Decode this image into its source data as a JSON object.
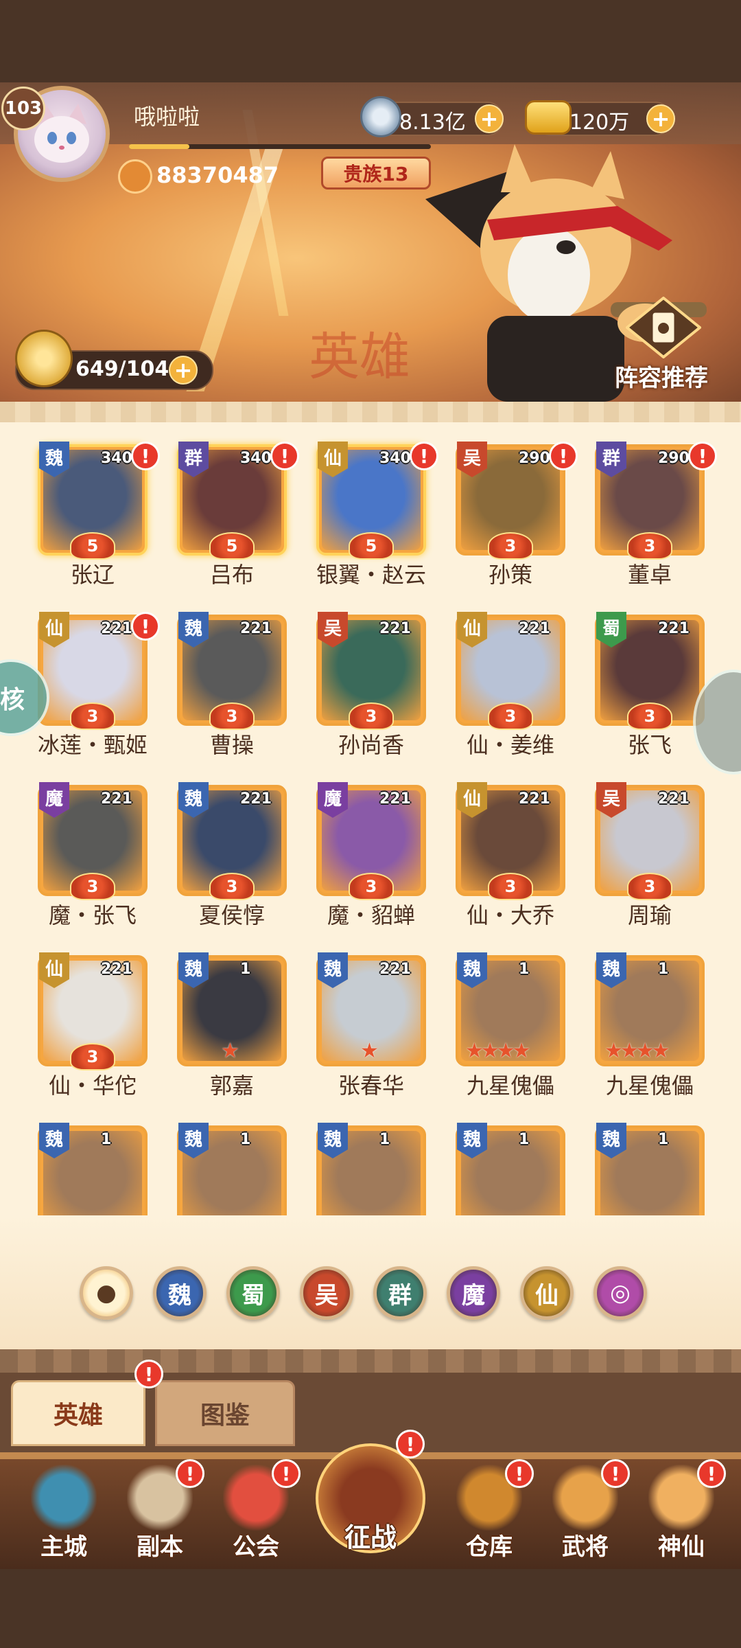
{
  "player": {
    "level": "103",
    "name": "哦啦啦",
    "power": "88370487",
    "xp_fraction": 0.2,
    "noble": "贵族13",
    "avatar_icon": "cat-avatar-icon"
  },
  "currencies": {
    "coins": "8.13亿",
    "coins_icon": "coin-icon",
    "gold": "120万",
    "gold_icon": "gold-ingot-icon",
    "plus": "+"
  },
  "stamina": {
    "value": "649/1040",
    "plus": "+"
  },
  "banner": {
    "hero_word": "英雄",
    "lineup_label": "阵容推荐"
  },
  "side": {
    "left_label": "核"
  },
  "colors": {
    "wei": "#3b66b0",
    "shu": "#3d9a4c",
    "wu": "#c8492c",
    "qun": "#5d4ca0",
    "mo": "#7a3fa0",
    "xian": "#c6932f",
    "alert": "#e8382b",
    "card_border": "#f0a33c"
  },
  "heroes": [
    {
      "name": "张辽",
      "faction": "魏",
      "level": "340",
      "stars": "5",
      "alert": "!",
      "art": "#4a5a7a"
    },
    {
      "name": "吕布",
      "faction": "群",
      "level": "340",
      "stars": "5",
      "alert": "!",
      "art": "#6a3c3a"
    },
    {
      "name": "银翼・赵云",
      "faction": "仙",
      "level": "340",
      "stars": "5",
      "alert": "!",
      "art": "#4a76c8"
    },
    {
      "name": "孙策",
      "faction": "吴",
      "level": "290",
      "stars": "3",
      "alert": "!",
      "art": "#8a6a3a"
    },
    {
      "name": "董卓",
      "faction": "群",
      "level": "290",
      "stars": "3",
      "alert": "!",
      "art": "#6a4a48"
    },
    {
      "name": "冰莲・甄姬",
      "faction": "仙",
      "level": "221",
      "stars": "3",
      "alert": "!",
      "art": "#d8d8e6"
    },
    {
      "name": "曹操",
      "faction": "魏",
      "level": "221",
      "stars": "3",
      "alert": "",
      "art": "#5a5a5a"
    },
    {
      "name": "孙尚香",
      "faction": "吴",
      "level": "221",
      "stars": "3",
      "alert": "",
      "art": "#3a6a5a"
    },
    {
      "name": "仙・姜维",
      "faction": "仙",
      "level": "221",
      "stars": "3",
      "alert": "",
      "art": "#b8c2d6"
    },
    {
      "name": "张飞",
      "faction": "蜀",
      "level": "221",
      "stars": "3",
      "alert": "",
      "art": "#5a3a3a"
    },
    {
      "name": "魔・张飞",
      "faction": "魔",
      "level": "221",
      "stars": "3",
      "alert": "",
      "art": "#5a5a58"
    },
    {
      "name": "夏侯惇",
      "faction": "魏",
      "level": "221",
      "stars": "3",
      "alert": "",
      "art": "#3a4a6a"
    },
    {
      "name": "魔・貂蝉",
      "faction": "魔",
      "level": "221",
      "stars": "3",
      "alert": "",
      "art": "#8a5aa8"
    },
    {
      "name": "仙・大乔",
      "faction": "仙",
      "level": "221",
      "stars": "3",
      "alert": "",
      "art": "#6a4a3a"
    },
    {
      "name": "周瑜",
      "faction": "吴",
      "level": "221",
      "stars": "3",
      "alert": "",
      "art": "#c8c8d0"
    },
    {
      "name": "仙・华佗",
      "faction": "仙",
      "level": "221",
      "stars": "3",
      "alert": "",
      "art": "#e6e2dc"
    },
    {
      "name": "郭嘉",
      "faction": "魏",
      "level": "1",
      "stars": "1",
      "alert": "",
      "art": "#3a3a42"
    },
    {
      "name": "张春华",
      "faction": "魏",
      "level": "221",
      "stars": "1",
      "alert": "",
      "art": "#c6ccd2"
    },
    {
      "name": "九星傀儡",
      "faction": "魏",
      "level": "1",
      "stars": "4",
      "alert": "",
      "art": "#a07a5a"
    },
    {
      "name": "九星傀儡",
      "faction": "魏",
      "level": "1",
      "stars": "4",
      "alert": "",
      "art": "#a07a5a"
    },
    {
      "name": "",
      "faction": "魏",
      "level": "1",
      "stars": "",
      "alert": "",
      "art": "#a07a5a"
    },
    {
      "name": "",
      "faction": "魏",
      "level": "1",
      "stars": "",
      "alert": "",
      "art": "#a07a5a"
    },
    {
      "name": "",
      "faction": "魏",
      "level": "1",
      "stars": "",
      "alert": "",
      "art": "#a07a5a"
    },
    {
      "name": "",
      "faction": "魏",
      "level": "1",
      "stars": "",
      "alert": "",
      "art": "#a07a5a"
    },
    {
      "name": "",
      "faction": "魏",
      "level": "1",
      "stars": "",
      "alert": "",
      "art": "#a07a5a"
    }
  ],
  "filters": [
    {
      "label": "",
      "icon": "paw-icon",
      "color": "#e8a33a"
    },
    {
      "label": "魏",
      "icon": "",
      "color": "#3b66b0"
    },
    {
      "label": "蜀",
      "icon": "",
      "color": "#3d9a4c"
    },
    {
      "label": "吴",
      "icon": "",
      "color": "#c8492c"
    },
    {
      "label": "群",
      "icon": "",
      "color": "#3f7f6f"
    },
    {
      "label": "魔",
      "icon": "",
      "color": "#7a3fa0"
    },
    {
      "label": "仙",
      "icon": "",
      "color": "#c6932f"
    },
    {
      "label": "",
      "icon": "swirl-icon",
      "color": "#b04ca8"
    }
  ],
  "tabs": {
    "hero": "英雄",
    "guide": "图鉴",
    "alert": "!"
  },
  "nav": [
    {
      "label": "主城",
      "icon": "castle-icon",
      "alert": ""
    },
    {
      "label": "副本",
      "icon": "sword-icon",
      "alert": "!"
    },
    {
      "label": "公会",
      "icon": "flag-icon",
      "alert": "!"
    },
    {
      "label": "征战",
      "icon": "battle-icon",
      "alert": "!"
    },
    {
      "label": "仓库",
      "icon": "bag-icon",
      "alert": "!"
    },
    {
      "label": "武将",
      "icon": "hero-cat-icon",
      "alert": "!"
    },
    {
      "label": "神仙",
      "icon": "deity-cat-icon",
      "alert": "!"
    }
  ]
}
